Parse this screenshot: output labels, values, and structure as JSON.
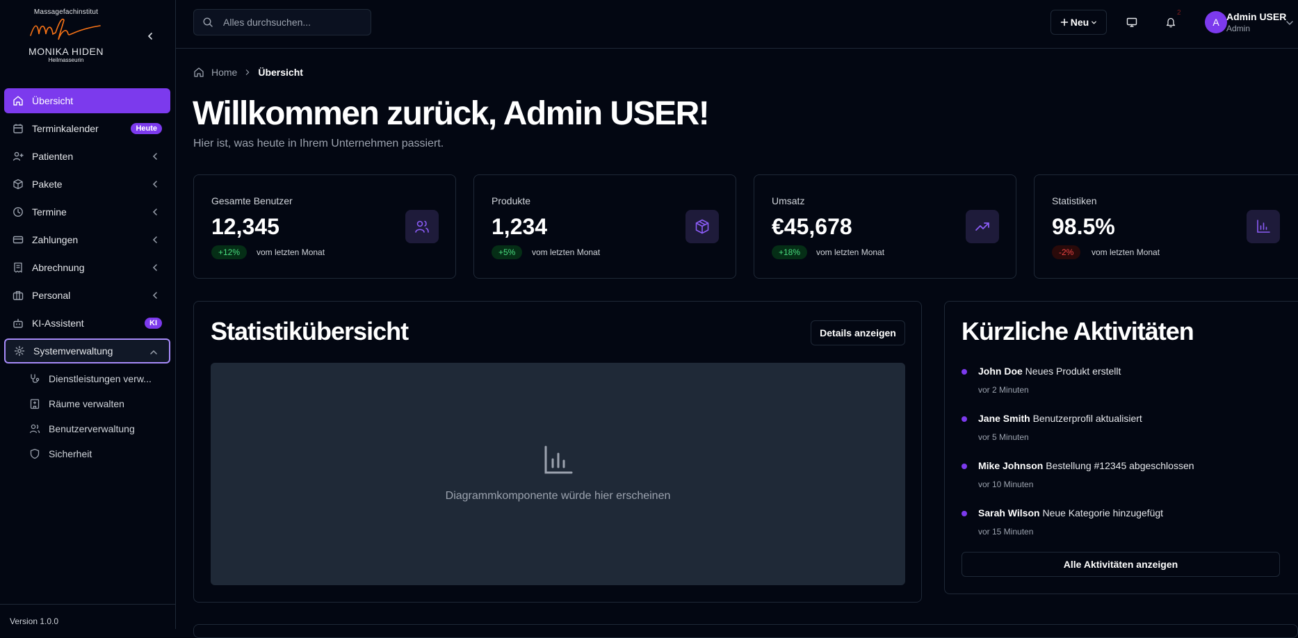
{
  "brand": {
    "top_text": "Massagefachinstitut",
    "name": "MONIKA HIDEN",
    "sub_text": "Heilmasseurin",
    "accent_color": "#7c3aed"
  },
  "sidebar": {
    "items": [
      {
        "label": "Übersicht",
        "icon": "home-icon"
      },
      {
        "label": "Terminkalender",
        "icon": "calendar-icon",
        "badge": "Heute"
      },
      {
        "label": "Patienten",
        "icon": "user-plus-icon"
      },
      {
        "label": "Pakete",
        "icon": "package-icon"
      },
      {
        "label": "Termine",
        "icon": "clock-icon"
      },
      {
        "label": "Zahlungen",
        "icon": "credit-card-icon"
      },
      {
        "label": "Abrechnung",
        "icon": "receipt-icon"
      },
      {
        "label": "Personal",
        "icon": "briefcase-icon"
      },
      {
        "label": "KI-Assistent",
        "icon": "bot-icon",
        "badge": "KI"
      },
      {
        "label": "Systemverwaltung",
        "icon": "gear-icon"
      }
    ],
    "sub_items": [
      {
        "label": "Dienstleistungen verw...",
        "icon": "stethoscope-icon"
      },
      {
        "label": "Räume verwalten",
        "icon": "hospital-icon"
      },
      {
        "label": "Benutzerverwaltung",
        "icon": "users-icon"
      },
      {
        "label": "Sicherheit",
        "icon": "shield-icon"
      }
    ],
    "version": "Version 1.0.0"
  },
  "topbar": {
    "search_placeholder": "Alles durchsuchen...",
    "new_label": "Neu",
    "notification_count": "2",
    "user_initial": "A",
    "user_name": "Admin USER",
    "user_role": "Admin"
  },
  "breadcrumb": {
    "home": "Home",
    "current": "Übersicht"
  },
  "header": {
    "title": "Willkommen zurück, Admin USER!",
    "subtitle": "Hier ist, was heute in Ihrem Unternehmen passiert."
  },
  "stats": [
    {
      "label": "Gesamte Benutzer",
      "value": "12,345",
      "change": "+12%",
      "trend": "up",
      "since": "vom letzten Monat",
      "icon": "users-icon"
    },
    {
      "label": "Produkte",
      "value": "1,234",
      "change": "+5%",
      "trend": "up",
      "since": "vom letzten Monat",
      "icon": "box-icon"
    },
    {
      "label": "Umsatz",
      "value": "€45,678",
      "change": "+18%",
      "trend": "up",
      "since": "vom letzten Monat",
      "icon": "trending-up-icon"
    },
    {
      "label": "Statistiken",
      "value": "98.5%",
      "change": "-2%",
      "trend": "down",
      "since": "vom letzten Monat",
      "icon": "bar-chart-icon"
    }
  ],
  "stats_panel": {
    "title": "Statistikübersicht",
    "details_label": "Details anzeigen",
    "placeholder": "Diagrammkomponente würde hier erscheinen"
  },
  "activity": {
    "title": "Kürzliche Aktivitäten",
    "items": [
      {
        "user": "John Doe",
        "action": "Neues Produkt erstellt",
        "time": "vor 2 Minuten"
      },
      {
        "user": "Jane Smith",
        "action": "Benutzerprofil aktualisiert",
        "time": "vor 5 Minuten"
      },
      {
        "user": "Mike Johnson",
        "action": "Bestellung #12345 abgeschlossen",
        "time": "vor 10 Minuten"
      },
      {
        "user": "Sarah Wilson",
        "action": "Neue Kategorie hinzugefügt",
        "time": "vor 15 Minuten"
      }
    ],
    "view_all_label": "Alle Aktivitäten anzeigen"
  }
}
